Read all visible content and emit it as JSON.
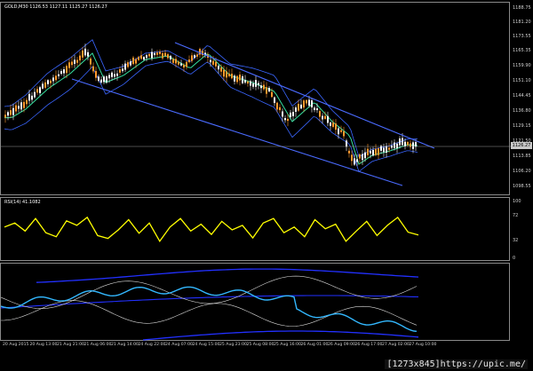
{
  "window": {
    "symbol_label": "GOLD,M30  1126.53 1127.11 1125.27 1126.27",
    "current_price": "1126.27"
  },
  "colors": {
    "background": "#000000",
    "candle_up": "#ffffff",
    "candle_down": "#ff9a2e",
    "bollinger": "#3a66ff",
    "moving_average": "#36e0a0",
    "channel": "#4a6bff",
    "rsi_line": "#ffff00",
    "macd_main": "#33b8ff",
    "macd_band": "#ffffff",
    "macd_envelope": "#2230ff"
  },
  "price_scale": [
    "1188.75",
    "1181.20",
    "1173.55",
    "1165.35",
    "1159.90",
    "1151.10",
    "1144.45",
    "1136.80",
    "1129.15",
    "1121.50",
    "1113.85",
    "1106.20",
    "1098.55"
  ],
  "rsi": {
    "label": "RSI(14) 41.1082",
    "scale": [
      "100",
      "72",
      "32",
      "0"
    ]
  },
  "date_axis": [
    "20 Aug 2015",
    "20 Aug 13:00",
    "21 Aug 21:00",
    "21 Aug 06:00",
    "21 Aug 14:00",
    "24 Aug 22:00",
    "24 Aug 07:00",
    "24 Aug 15:00",
    "25 Aug 23:00",
    "25 Aug 08:00",
    "25 Aug 16:00",
    "26 Aug 01:00",
    "26 Aug 09:00",
    "26 Aug 17:00",
    "27 Aug 02:00",
    "27 Aug 10:00"
  ],
  "chart_data": {
    "type": "line",
    "title": "GOLD,M30  1126.53 1127.11 1125.27 1126.27",
    "series": [
      {
        "name": "RSI(14) 41.1082",
        "values": [
          55,
          62,
          48,
          70,
          45,
          38,
          66,
          58,
          72,
          40,
          35,
          50,
          68,
          44,
          62,
          30,
          55,
          70,
          48,
          60,
          42,
          65,
          50,
          58,
          36,
          62,
          70,
          45,
          55,
          38,
          68,
          52,
          60,
          30,
          48,
          65,
          40,
          58,
          72,
          46,
          41
        ]
      }
    ]
  },
  "watermark": "[1273x845]https://upic.me/"
}
